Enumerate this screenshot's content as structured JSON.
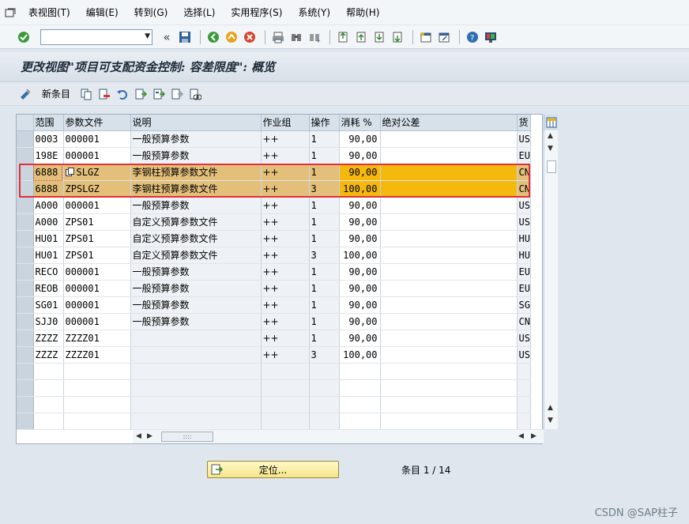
{
  "menu": {
    "items": [
      "表视图(T)",
      "编辑(E)",
      "转到(G)",
      "选择(L)",
      "实用程序(S)",
      "系统(Y)",
      "帮助(H)"
    ]
  },
  "toolbar": {
    "command_value": "",
    "back_glyph": "«"
  },
  "screen": {
    "title": "更改视图\"项目可支配资金控制: 容差限度\": 概览"
  },
  "app_toolbar": {
    "new_entries_label": "新条目"
  },
  "table": {
    "columns": [
      "范围",
      "参数文件",
      "说明",
      "作业组",
      "操作",
      "消耗 %",
      "绝对公差",
      "货"
    ],
    "rows": [
      [
        "0003",
        "000001",
        "一般预算参数",
        "++",
        "1",
        "90,00",
        "",
        "US"
      ],
      [
        "198E",
        "000001",
        "一般预算参数",
        "++",
        "1",
        "90,00",
        "",
        "EU"
      ],
      [
        "6888",
        "SLGZ",
        "李钢柱预算参数文件",
        "++",
        "1",
        "90,00",
        "",
        "CN"
      ],
      [
        "6888",
        "ZPSLGZ",
        "李钢柱预算参数文件",
        "++",
        "3",
        "100,00",
        "",
        "CN"
      ],
      [
        "A000",
        "000001",
        "一般预算参数",
        "++",
        "1",
        "90,00",
        "",
        "US"
      ],
      [
        "A000",
        "ZPS01",
        "自定义预算参数文件",
        "++",
        "1",
        "90,00",
        "",
        "US"
      ],
      [
        "HU01",
        "ZPS01",
        "自定义预算参数文件",
        "++",
        "1",
        "90,00",
        "",
        "HU"
      ],
      [
        "HU01",
        "ZPS01",
        "自定义预算参数文件",
        "++",
        "3",
        "100,00",
        "",
        "HU"
      ],
      [
        "RECO",
        "000001",
        "一般预算参数",
        "++",
        "1",
        "90,00",
        "",
        "EU"
      ],
      [
        "REOB",
        "000001",
        "一般预算参数",
        "++",
        "1",
        "90,00",
        "",
        "EU"
      ],
      [
        "SG01",
        "000001",
        "一般预算参数",
        "++",
        "1",
        "90,00",
        "",
        "SG"
      ],
      [
        "SJJ0",
        "000001",
        "一般预算参数",
        "++",
        "1",
        "90,00",
        "",
        "CN"
      ],
      [
        "ZZZZ",
        "ZZZZ01",
        "",
        "++",
        "1",
        "90,00",
        "",
        "US"
      ],
      [
        "ZZZZ",
        "ZZZZ01",
        "",
        "++",
        "3",
        "100,00",
        "",
        "US"
      ]
    ],
    "empty_rows": 4,
    "highlighted_rows": [
      2,
      3
    ]
  },
  "footer": {
    "locate_label": "定位...",
    "entry_info": "条目 1 / 14"
  },
  "watermark": "CSDN @SAP柱子",
  "colors": {
    "highlight_row": "#e3bf7a",
    "highlight_cell": "#f5b80c",
    "annotation_box": "#e0303a"
  }
}
